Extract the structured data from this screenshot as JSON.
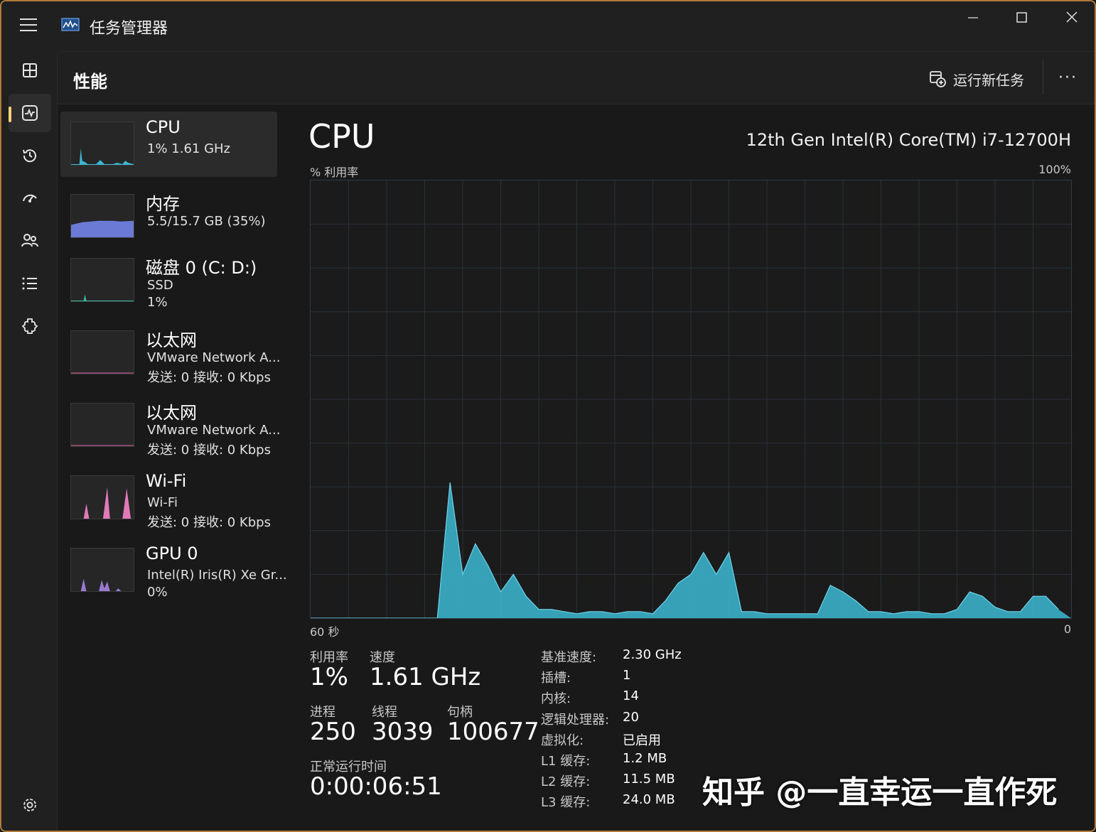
{
  "window": {
    "title": "任务管理器"
  },
  "header": {
    "page_title": "性能",
    "run_new_task": "运行新任务",
    "more": "···"
  },
  "nav": {
    "items": [
      {
        "icon": "processes-icon"
      },
      {
        "icon": "performance-icon"
      },
      {
        "icon": "app-history-icon"
      },
      {
        "icon": "startup-apps-icon"
      },
      {
        "icon": "users-icon"
      },
      {
        "icon": "details-icon"
      },
      {
        "icon": "services-icon"
      }
    ],
    "settings_icon": "settings-icon"
  },
  "devices": [
    {
      "name": "CPU",
      "line1": "1%  1.61 GHz",
      "line2": "",
      "color": "#3cb8d4"
    },
    {
      "name": "内存",
      "line1": "5.5/15.7 GB (35%)",
      "line2": "",
      "color": "#6b7ad4"
    },
    {
      "name": "磁盘 0 (C: D:)",
      "line1": "SSD",
      "line2": "1%",
      "color": "#3cb8a0"
    },
    {
      "name": "以太网",
      "line1": "VMware Network A...",
      "line2": "发送: 0 接收: 0 Kbps",
      "color": "#d86ba8"
    },
    {
      "name": "以太网",
      "line1": "VMware Network A...",
      "line2": "发送: 0 接收: 0 Kbps",
      "color": "#d86ba8"
    },
    {
      "name": "Wi-Fi",
      "line1": "Wi-Fi",
      "line2": "发送: 0 接收: 0 Kbps",
      "color": "#e07ab8"
    },
    {
      "name": "GPU 0",
      "line1": "Intel(R) Iris(R) Xe Gr...",
      "line2": "0%",
      "color": "#9a7ad0"
    }
  ],
  "detail": {
    "title": "CPU",
    "model": "12th Gen Intel(R) Core(TM) i7-12700H",
    "util_label": "% 利用率",
    "util_max": "100%",
    "time_left": "60 秒",
    "time_right": "0",
    "stats": {
      "utilization_label": "利用率",
      "utilization": "1%",
      "speed_label": "速度",
      "speed": "1.61 GHz",
      "processes_label": "进程",
      "processes": "250",
      "threads_label": "线程",
      "threads": "3039",
      "handles_label": "句柄",
      "handles": "100677",
      "uptime_label": "正常运行时间",
      "uptime": "0:00:06:51"
    },
    "specs": [
      {
        "key": "基准速度:",
        "value": "2.30 GHz"
      },
      {
        "key": "插槽:",
        "value": "1"
      },
      {
        "key": "内核:",
        "value": "14"
      },
      {
        "key": "逻辑处理器:",
        "value": "20"
      },
      {
        "key": "虚拟化:",
        "value": "已启用"
      },
      {
        "key": "L1 缓存:",
        "value": "1.2 MB"
      },
      {
        "key": "L2 缓存:",
        "value": "11.5 MB"
      },
      {
        "key": "L3 缓存:",
        "value": "24.0 MB"
      }
    ]
  },
  "watermark": "知乎 @一直幸运一直作死",
  "chart_data": {
    "type": "area",
    "title": "CPU",
    "ylabel": "% 利用率",
    "ylim": [
      0,
      100
    ],
    "xlim": [
      60,
      0
    ],
    "x": [
      60,
      59,
      58,
      57,
      56,
      55,
      54,
      53,
      52,
      51,
      50,
      49,
      48,
      47,
      46,
      45,
      44,
      43,
      42,
      41,
      40,
      39,
      38,
      37,
      36,
      35,
      34,
      33,
      32,
      31,
      30,
      29,
      28,
      27,
      26,
      25,
      24,
      23,
      22,
      21,
      20,
      19,
      18,
      17,
      16,
      15,
      14,
      13,
      12,
      11,
      10,
      9,
      8,
      7,
      6,
      5,
      4,
      3,
      2,
      1,
      0
    ],
    "series": [
      {
        "values": [
          0,
          0,
          0,
          0,
          0,
          0,
          0,
          0,
          0,
          0,
          0,
          31,
          10,
          17,
          12,
          6,
          10,
          5,
          2,
          2,
          1.5,
          1,
          1.5,
          1.5,
          1,
          1.5,
          1.5,
          1,
          4,
          8,
          10,
          15,
          10,
          15,
          1.5,
          1.5,
          1,
          1,
          1,
          1,
          1,
          7.5,
          6,
          4,
          1.5,
          1.5,
          1,
          1.5,
          1.5,
          1,
          1,
          2,
          6,
          5,
          2.5,
          1.5,
          1.5,
          5,
          5,
          2
        ],
        "color": "#3cb8d4"
      }
    ],
    "grid": true
  }
}
